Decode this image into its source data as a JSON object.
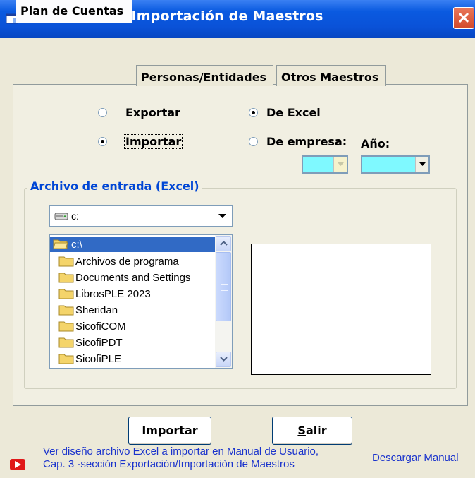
{
  "window": {
    "title": "Exportación / Importación de Maestros",
    "close_label": "×"
  },
  "tabs": [
    {
      "label": "Plan de Cuentas",
      "active": true
    },
    {
      "label": "Personas/Entidades",
      "active": false
    },
    {
      "label": "Otros Maestros",
      "active": false
    }
  ],
  "options": {
    "exportar": {
      "label": "Exportar",
      "selected": false
    },
    "importar": {
      "label": "Importar",
      "selected": true
    },
    "de_excel": {
      "label": "De Excel",
      "selected": true
    },
    "de_empresa": {
      "label": "De empresa:",
      "selected": false
    },
    "anio_label": "Año:"
  },
  "archivo": {
    "group_title": "Archivo de entrada (Excel)",
    "drive": "c:",
    "directories": [
      {
        "name": "c:\\",
        "selected": true,
        "open": true
      },
      {
        "name": "Archivos de programa",
        "selected": false
      },
      {
        "name": "Documents and Settings",
        "selected": false
      },
      {
        "name": "LibrosPLE 2023",
        "selected": false
      },
      {
        "name": "Sheridan",
        "selected": false
      },
      {
        "name": "SicofiCOM",
        "selected": false
      },
      {
        "name": "SicofiPDT",
        "selected": false
      },
      {
        "name": "SicofiPLE",
        "selected": false
      }
    ]
  },
  "buttons": {
    "importar": "Importar",
    "salir_first": "S",
    "salir_rest": "alir"
  },
  "footer": {
    "help_line1": "Ver diseño archivo Excel a importar en Manual de Usuario,",
    "help_line2": "Cap. 3 -sección Exportación/Importaciòn de Maestros",
    "download_link": "Descargar Manual"
  },
  "colors": {
    "titlebar": "#0a52d8",
    "window_bg": "#ece9d8",
    "group_title": "#0046d5",
    "combo_fill": "#7ff9ff",
    "link": "#1a33cc",
    "selection": "#316ac5"
  }
}
